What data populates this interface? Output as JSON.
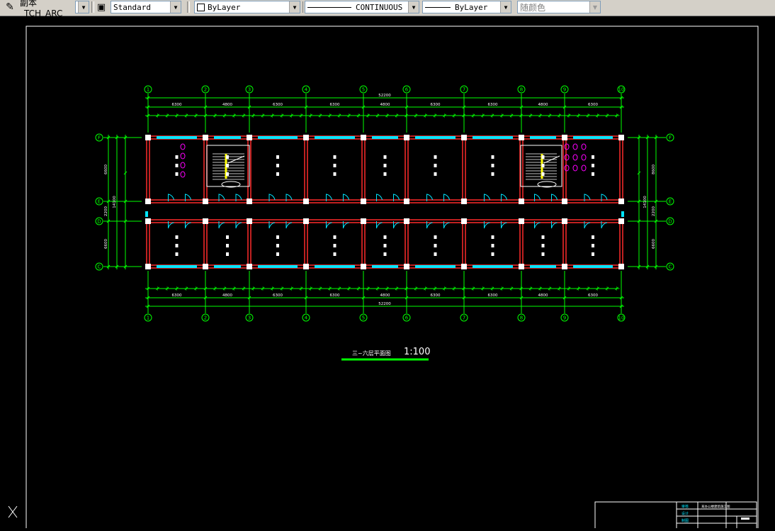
{
  "toolbar": {
    "text_style_label": "副本 _TCH_ARC",
    "dim_style_value": "Standard",
    "layer_value": "ByLayer",
    "linetype_value": "CONTINUOUS",
    "lineweight_value": "ByLayer",
    "color_value": "随颜色"
  },
  "drawing": {
    "axis_labels": [
      "1",
      "2",
      "3",
      "4",
      "5",
      "6",
      "7",
      "8",
      "9",
      "10"
    ],
    "row_labels": [
      "F",
      "E",
      "D",
      "C"
    ],
    "bay_dims": [
      "6300",
      "4800",
      "6300",
      "6300",
      "4800",
      "6300",
      "6300",
      "4800",
      "6300"
    ],
    "overall_dim": "52200",
    "left_dims": [
      "6600",
      "8600",
      "2200",
      "14100",
      "6600",
      "6600"
    ],
    "title": "三~六层平面图",
    "scale": "1:100"
  },
  "titleblock": {
    "label_1": "审核",
    "label_2": "设计",
    "label_3": "制图",
    "project": "某办公楼建筑施工图"
  },
  "colors": {
    "wall": "#ff2a2a",
    "dim": "#00ff00",
    "text": "#ffffff",
    "window": "#00e5ff",
    "stair": "#ffff00",
    "toilet": "#ff00ff"
  }
}
